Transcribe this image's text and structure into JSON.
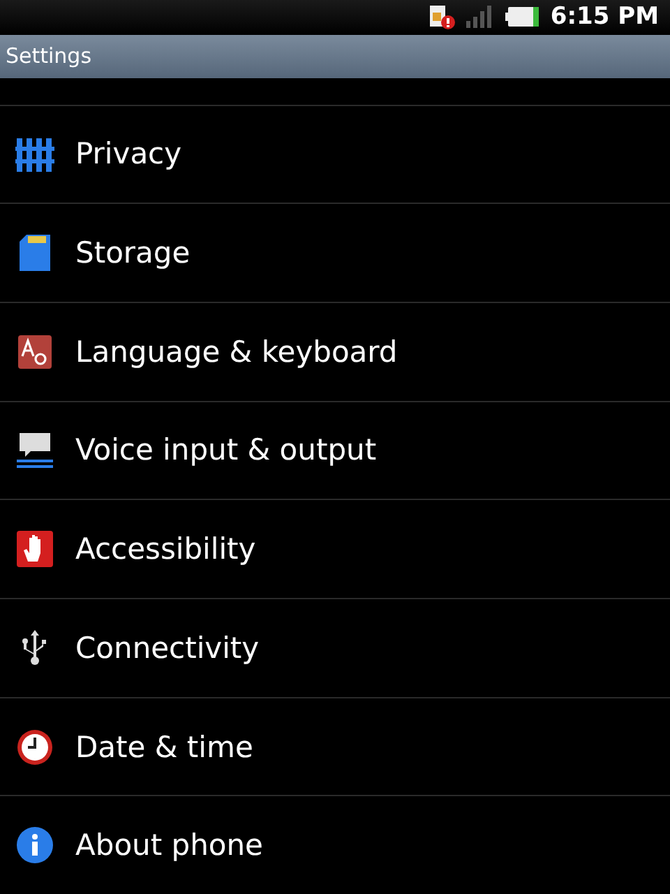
{
  "status_bar": {
    "time": "6:15 PM"
  },
  "title_bar": {
    "title": "Settings"
  },
  "items": [
    {
      "label": "Privacy"
    },
    {
      "label": "Storage"
    },
    {
      "label": "Language & keyboard"
    },
    {
      "label": "Voice input & output"
    },
    {
      "label": "Accessibility"
    },
    {
      "label": "Connectivity"
    },
    {
      "label": "Date & time"
    },
    {
      "label": "About phone"
    }
  ]
}
